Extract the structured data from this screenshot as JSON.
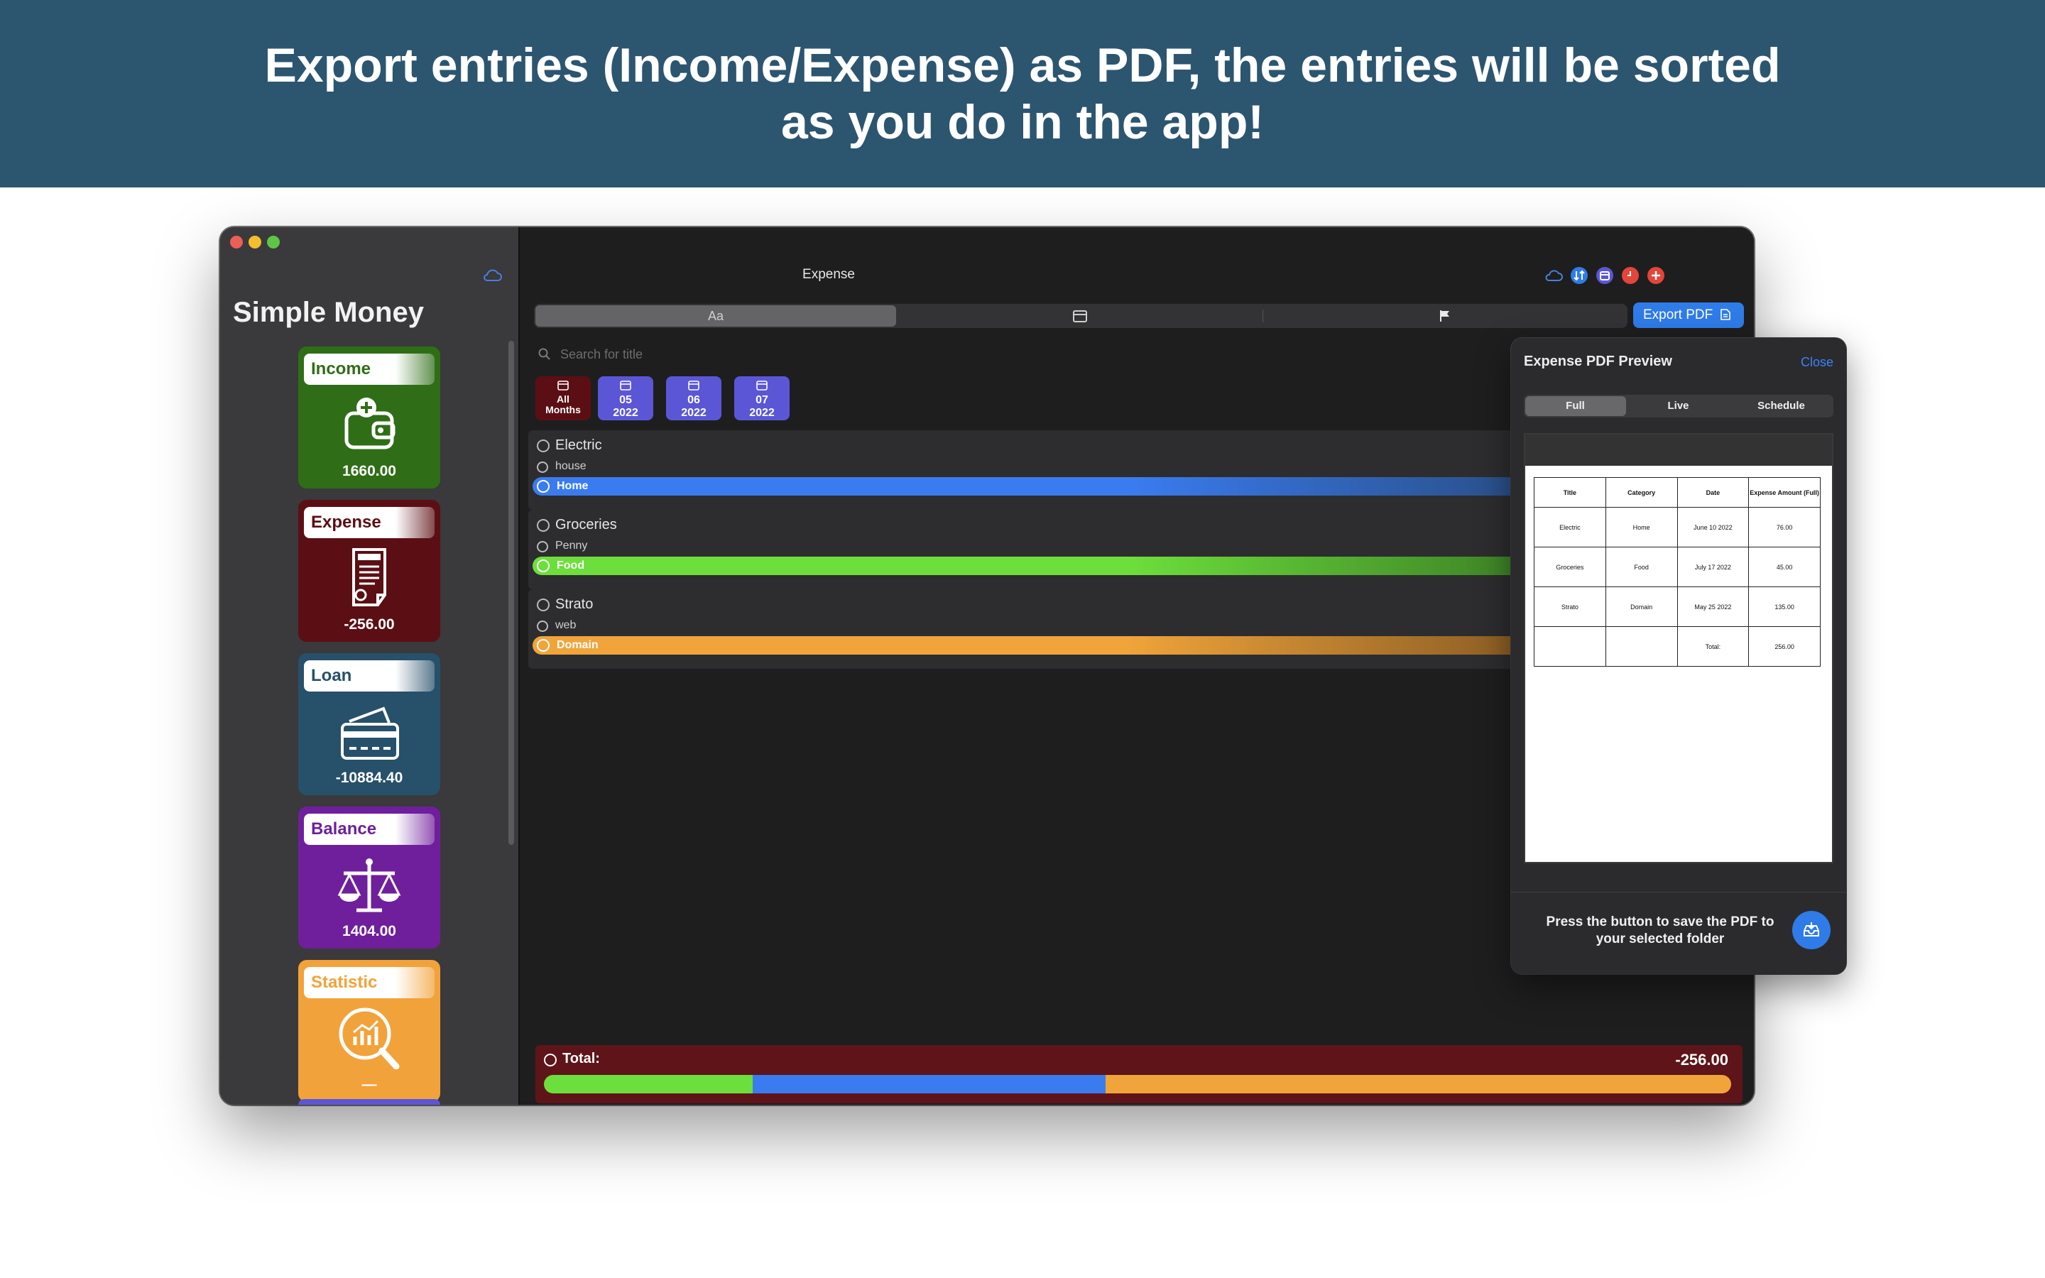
{
  "banner": {
    "text": "Export entries (Income/Expense) as PDF, the entries will be sorted as you do in the app!"
  },
  "app": {
    "title": "Simple Money"
  },
  "sidebar": {
    "cards": [
      {
        "label": "Income",
        "value": "1660.00",
        "color": "#2f6e17",
        "label_color": "#2f6e17"
      },
      {
        "label": "Expense",
        "value": "-256.00",
        "color": "#5b0f14",
        "label_color": "#5b0f14"
      },
      {
        "label": "Loan",
        "value": "-10884.40",
        "color": "#27506a",
        "label_color": "#27506a"
      },
      {
        "label": "Balance",
        "value": "1404.00",
        "color": "#6f1f9c",
        "label_color": "#6f1f9c"
      },
      {
        "label": "Statistic",
        "value": "—",
        "color": "#f2a23a",
        "label_color": "#f2a23a"
      }
    ]
  },
  "main": {
    "title": "Expense",
    "segments": [
      "Aa",
      "calendar-icon",
      "flag-icon"
    ],
    "export_label": "Export PDF",
    "search_placeholder": "Search for title",
    "chips": [
      {
        "line1": "All",
        "line2": "Months",
        "color": "#5b0f14"
      },
      {
        "line1": "05",
        "line2": "2022",
        "color": "#5b56d6"
      },
      {
        "line1": "06",
        "line2": "2022",
        "color": "#5b56d6"
      },
      {
        "line1": "07",
        "line2": "2022",
        "color": "#5b56d6"
      }
    ],
    "entries": [
      {
        "title": "Electric",
        "sub": "house",
        "category": "Home",
        "color": "#3a7cf0"
      },
      {
        "title": "Groceries",
        "sub": "Penny",
        "category": "Food",
        "color": "#6ddf3c"
      },
      {
        "title": "Strato",
        "sub": "web",
        "category": "Domain",
        "color": "#f0a43a"
      }
    ],
    "total_label": "Total:",
    "total_value": "-256.00",
    "total_shares": [
      {
        "category": "Food",
        "share": 0.176,
        "color": "#6ddf3c"
      },
      {
        "category": "Home",
        "share": 0.297,
        "color": "#3a7cf0"
      },
      {
        "category": "Domain",
        "share": 0.527,
        "color": "#f0a43a"
      }
    ]
  },
  "popover": {
    "title": "Expense PDF Preview",
    "close": "Close",
    "segments": [
      "Full",
      "Live",
      "Schedule"
    ],
    "table_headers": [
      "Title",
      "Category",
      "Date",
      "Expense Amount (Full)"
    ],
    "table_rows": [
      [
        "Electric",
        "Home",
        "June 10 2022",
        "76.00"
      ],
      [
        "Groceries",
        "Food",
        "July 17 2022",
        "45.00"
      ],
      [
        "Strato",
        "Domain",
        "May 25 2022",
        "135.00"
      ],
      [
        "",
        "",
        "Total:",
        "256.00"
      ]
    ],
    "note": "Press the button to save the PDF to your selected folder"
  }
}
